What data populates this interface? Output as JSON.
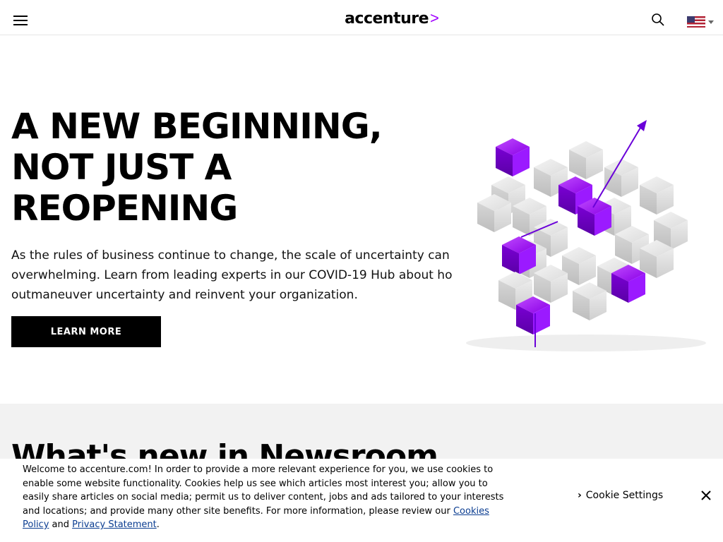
{
  "header": {
    "logo_text": "accenture",
    "logo_mark": ">"
  },
  "hero": {
    "heading": "A NEW BEGINNING, NOT JUST A REOPENING",
    "body": "As the rules of business continue to change, the scale of uncertainty can be overwhelming. Learn from leading experts in our COVID-19 Hub about how to outmaneuver uncertainty and reinvent your organization.",
    "cta_label": "LEARN MORE"
  },
  "lower": {
    "heading": "What's new in Newsroom"
  },
  "cookie_banner": {
    "text_main": "Welcome to accenture.com! In order to provide a more relevant experience for you, we use cookies to enable some website functionality. Cookies help us see which articles most interest you; allow you to easily share articles on social media; permit us to deliver content, jobs and ads tailored to your interests and locations; and provide many other site benefits. For more information, please review our ",
    "cookies_policy_link": "Cookies Policy",
    "and_text": " and ",
    "privacy_link": "Privacy Statement",
    "end_text": ".",
    "settings_label": "Cookie Settings",
    "settings_chevron": "›"
  },
  "colors": {
    "accent": "#a100ff",
    "cube_gray": "#e6e6e6",
    "button_bg": "#000000",
    "link": "#0b3d91"
  },
  "icons": {
    "menu": "hamburger-icon",
    "search": "search-icon",
    "flag": "us-flag-icon",
    "close": "close-icon"
  }
}
